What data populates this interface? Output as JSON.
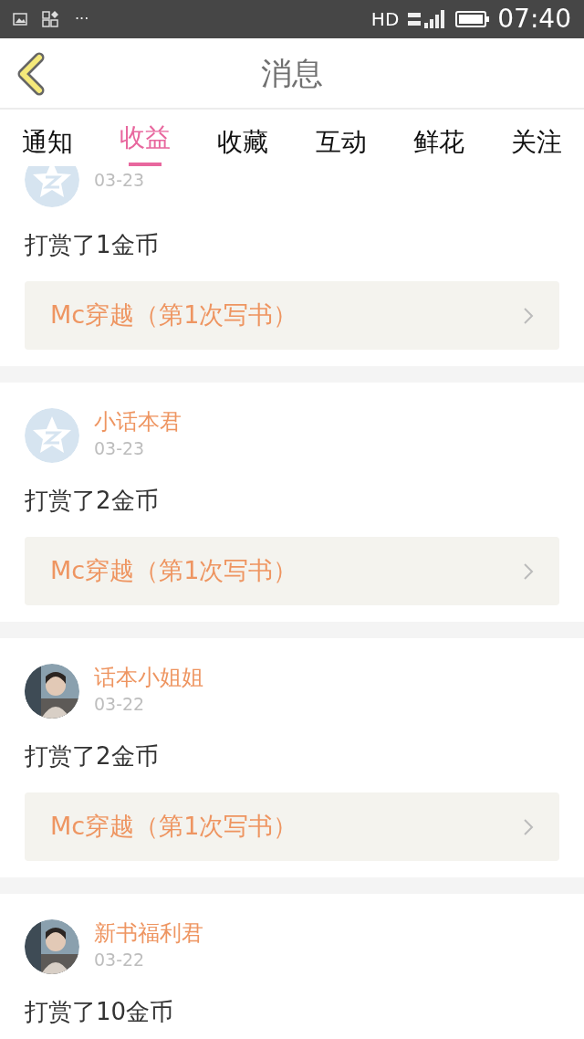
{
  "status_bar": {
    "time": "07:40",
    "network": "HD",
    "dots": "···"
  },
  "header": {
    "title": "消息"
  },
  "tabs": [
    {
      "label": "通知",
      "selected": false
    },
    {
      "label": "收益",
      "selected": true
    },
    {
      "label": "收藏",
      "selected": false
    },
    {
      "label": "互动",
      "selected": false
    },
    {
      "label": "鲜花",
      "selected": false
    },
    {
      "label": "关注",
      "selected": false
    }
  ],
  "messages": [
    {
      "avatar": {
        "kind": "default"
      },
      "date": "03-23",
      "text": "打赏了1金币",
      "book": "Mc穿越（第1次写书）"
    },
    {
      "avatar": {
        "kind": "default"
      },
      "name": "小话本君",
      "date": "03-23",
      "text": "打赏了2金币",
      "book": "Mc穿越（第1次写书）"
    },
    {
      "name": "话本小姐姐",
      "date": "03-22",
      "text": "打赏了2金币",
      "book": "Mc穿越（第1次写书）"
    },
    {
      "name": "新书福利君",
      "date": "03-22",
      "text": "打赏了10金币"
    }
  ]
}
